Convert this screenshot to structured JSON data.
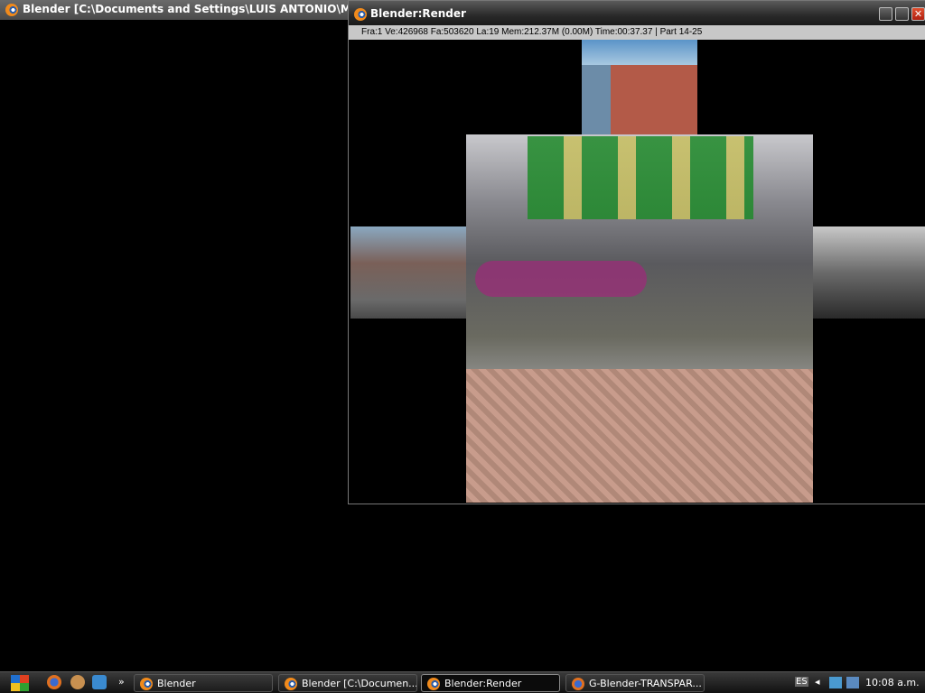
{
  "main_window": {
    "title": "Blender [C:\\Documents and Settings\\LUIS ANTONIO\\Mi"
  },
  "render_window": {
    "title": "Blender:Render",
    "status": "Fra:1  Ve:426968 Fa:503620 La:19 Mem:212.37M (0.00M) Time:00:37.37 | Part 14-25",
    "close_glyph": "✕"
  },
  "taskbar": {
    "more": "»",
    "tasks": [
      {
        "label": "Blender"
      },
      {
        "label": "Blender [C:\\Documen..."
      },
      {
        "label": "Blender:Render"
      },
      {
        "label": "G-Blender-TRANSPAR..."
      }
    ],
    "lang": "ES",
    "tray_arrow": "◂",
    "clock": "10:08 a.m."
  }
}
